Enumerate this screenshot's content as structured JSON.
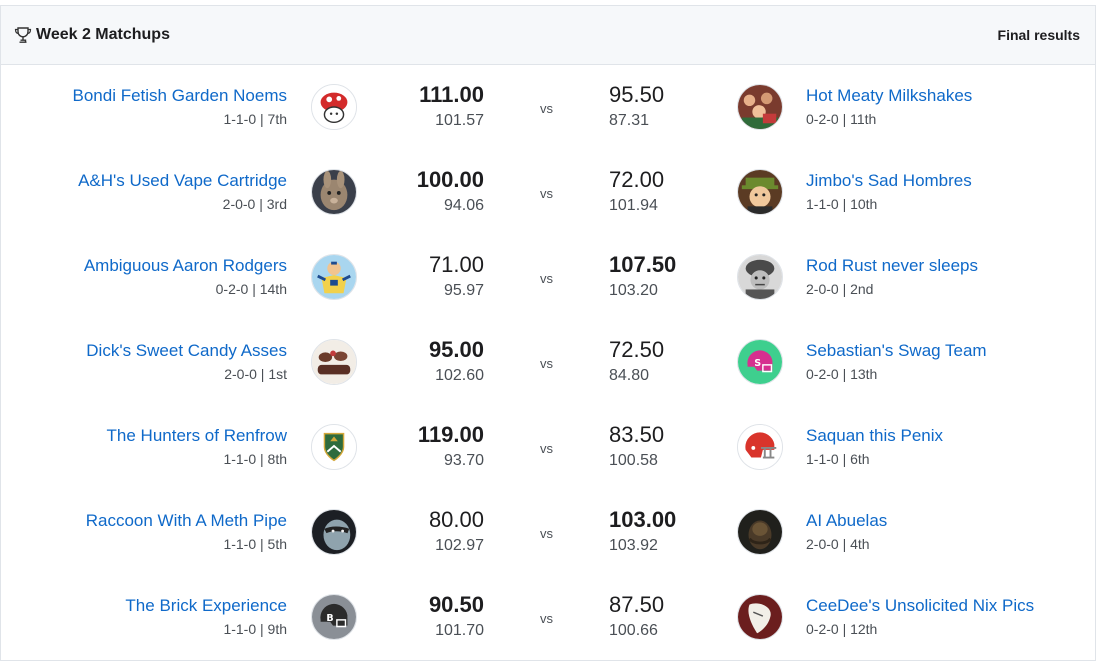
{
  "header": {
    "title": "Week 2 Matchups",
    "status": "Final results"
  },
  "vs_label": "vs",
  "matchups": [
    {
      "left": {
        "name": "Bondi Fetish Garden Noems",
        "record": "1-1-0 | 7th",
        "score": "111.00",
        "proj": "101.57",
        "win": true
      },
      "right": {
        "name": "Hot Meaty Milkshakes",
        "record": "0-2-0 | 11th",
        "score": "95.50",
        "proj": "87.31",
        "win": false
      }
    },
    {
      "left": {
        "name": "A&H's Used Vape Cartridge",
        "record": "2-0-0 | 3rd",
        "score": "100.00",
        "proj": "94.06",
        "win": true
      },
      "right": {
        "name": "Jimbo's Sad Hombres",
        "record": "1-1-0 | 10th",
        "score": "72.00",
        "proj": "101.94",
        "win": false
      }
    },
    {
      "left": {
        "name": "Ambiguous Aaron Rodgers",
        "record": "0-2-0 | 14th",
        "score": "71.00",
        "proj": "95.97",
        "win": false
      },
      "right": {
        "name": "Rod Rust never sleeps",
        "record": "2-0-0 | 2nd",
        "score": "107.50",
        "proj": "103.20",
        "win": true
      }
    },
    {
      "left": {
        "name": "Dick's Sweet Candy Asses",
        "record": "2-0-0 | 1st",
        "score": "95.00",
        "proj": "102.60",
        "win": true
      },
      "right": {
        "name": "Sebastian's Swag Team",
        "record": "0-2-0 | 13th",
        "score": "72.50",
        "proj": "84.80",
        "win": false
      }
    },
    {
      "left": {
        "name": "The Hunters of Renfrow",
        "record": "1-1-0 | 8th",
        "score": "119.00",
        "proj": "93.70",
        "win": true
      },
      "right": {
        "name": "Saquan this Penix",
        "record": "1-1-0 | 6th",
        "score": "83.50",
        "proj": "100.58",
        "win": false
      }
    },
    {
      "left": {
        "name": "Raccoon With A Meth Pipe",
        "record": "1-1-0 | 5th",
        "score": "80.00",
        "proj": "102.97",
        "win": false
      },
      "right": {
        "name": "AI Abuelas",
        "record": "2-0-0 | 4th",
        "score": "103.00",
        "proj": "103.92",
        "win": true
      }
    },
    {
      "left": {
        "name": "The Brick Experience",
        "record": "1-1-0 | 9th",
        "score": "90.50",
        "proj": "101.70",
        "win": true
      },
      "right": {
        "name": "CeeDee's Unsolicited Nix Pics",
        "record": "0-2-0 | 12th",
        "score": "87.50",
        "proj": "100.66",
        "win": false
      }
    }
  ],
  "colors": {
    "link": "#0f69c9",
    "header_bg": "#f6f8fa",
    "border": "#e0e4e9"
  },
  "icons": {
    "header": "trophy-icon"
  },
  "avatar_icons": {
    "left": [
      "mushroom-avatar",
      "rabbit-avatar",
      "superhero-avatar",
      "candy-avatar",
      "shield-logo-avatar",
      "raccoon-avatar",
      "helmet-b-avatar"
    ],
    "right": [
      "crowd-avatar",
      "cartoon-character-avatar",
      "soldier-avatar",
      "helmet-s-avatar",
      "football-helmet-avatar",
      "dark-figure-avatar",
      "guitar-pick-avatar"
    ]
  }
}
